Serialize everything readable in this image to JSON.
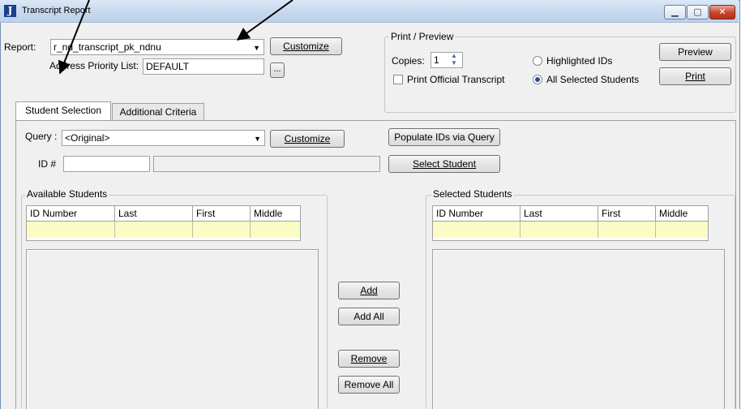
{
  "window": {
    "title": "Transcript Report",
    "app_icon_letter": "J",
    "controls": {
      "minimize": "▁",
      "maximize": "▢",
      "close": "✕"
    }
  },
  "report": {
    "label": "Report:",
    "value": "r_nd_transcript_pk_ndnu",
    "customize_label": "Customize",
    "address_priority_label": "Address Priority List:",
    "address_priority_value": "DEFAULT",
    "ellipsis_label": "..."
  },
  "print_preview": {
    "group_title": "Print / Preview",
    "copies_label": "Copies:",
    "copies_value": "1",
    "official_transcript_label": "Print Official Transcript",
    "official_transcript_checked": false,
    "radio_highlighted_label": "Highlighted IDs",
    "radio_all_selected_label": "All Selected Students",
    "selected_radio": "All Selected Students",
    "preview_label": "Preview",
    "print_label": "Print"
  },
  "tabs": [
    {
      "label": "Student Selection",
      "active": true
    },
    {
      "label": "Additional Criteria",
      "active": false
    }
  ],
  "query": {
    "label": "Query :",
    "value": "<Original>",
    "customize_label": "Customize",
    "populate_label": "Populate IDs via Query"
  },
  "id_field": {
    "label": "ID #",
    "value": "",
    "name_display": "",
    "select_student_label": "Select Student"
  },
  "available": {
    "group_title": "Available Students",
    "columns": [
      "ID Number",
      "Last",
      "First",
      "Middle"
    ]
  },
  "selected": {
    "group_title": "Selected Students",
    "columns": [
      "ID Number",
      "Last",
      "First",
      "Middle"
    ]
  },
  "transfer_buttons": {
    "add": "Add",
    "add_all": "Add All",
    "remove": "Remove",
    "remove_all": "Remove All"
  },
  "colors": {
    "filter_row": "#fbfbc6",
    "title_bar": "#c6d8ee",
    "close_button": "#c8432c",
    "radio_selected": "#1c4fa8"
  }
}
